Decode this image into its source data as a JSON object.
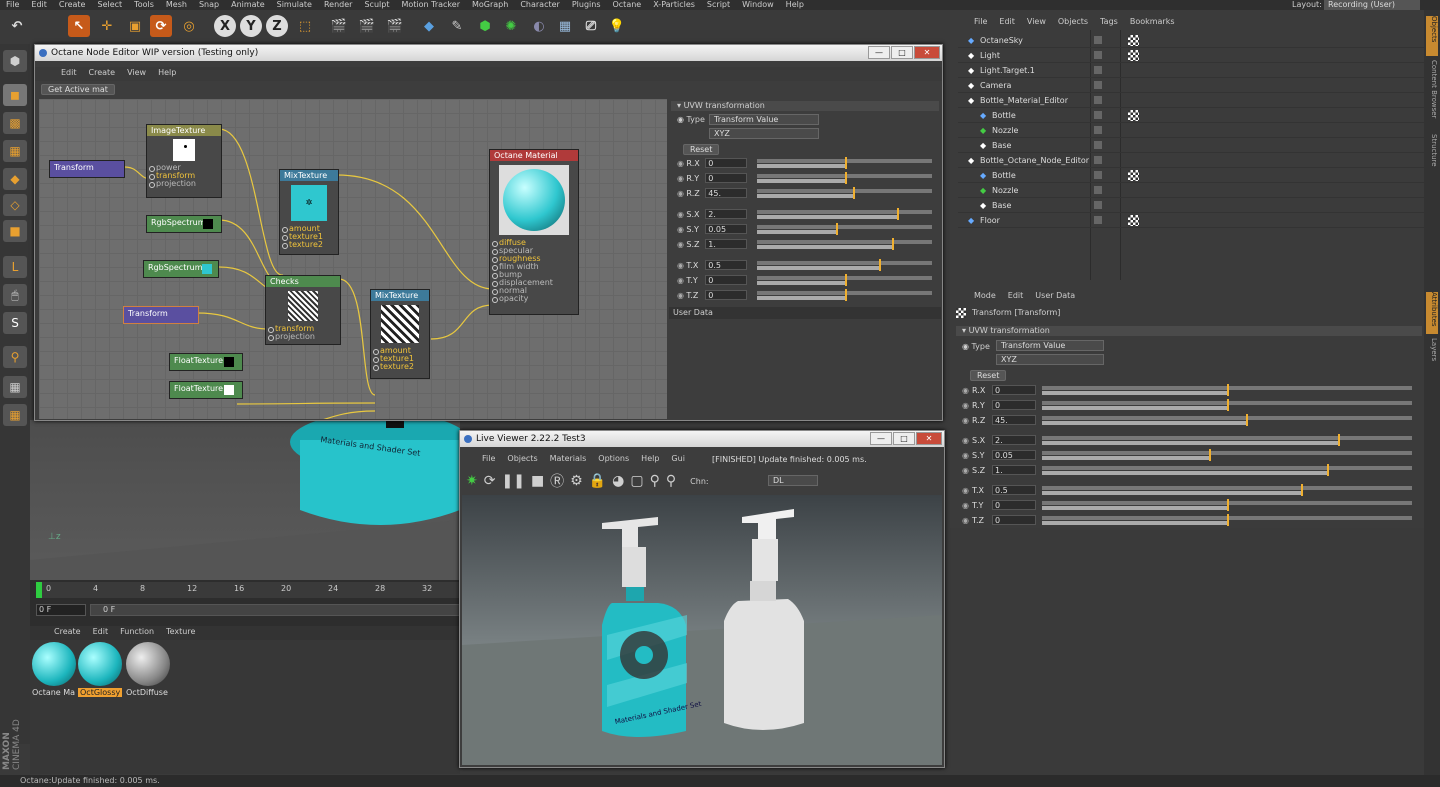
{
  "app": {
    "menu": [
      "File",
      "Edit",
      "Create",
      "Select",
      "Tools",
      "Mesh",
      "Snap",
      "Animate",
      "Simulate",
      "Render",
      "Sculpt",
      "Motion Tracker",
      "MoGraph",
      "Character",
      "Plugins",
      "Octane",
      "X-Particles",
      "Script",
      "Window",
      "Help"
    ],
    "layout_label": "Layout:",
    "layout_value": "Recording (User)",
    "status": "Octane:Update finished: 0.005 ms.",
    "brand1": "MAXON",
    "brand2": "CINEMA 4D"
  },
  "node_editor": {
    "title": "Octane Node Editor WIP version (Testing only)",
    "menu": [
      "Edit",
      "Create",
      "View",
      "Help"
    ],
    "get_active": "Get Active mat",
    "nodes": {
      "imagetexture": "ImageTexture",
      "transform1": "Transform",
      "rgb1": "RgbSpectrum",
      "rgb2": "RgbSpectrum",
      "mix1": "MixTexture",
      "checks": "Checks",
      "transform2": "Transform",
      "mix2": "MixTexture",
      "float1": "FloatTexture",
      "float2": "FloatTexture",
      "material": "Octane Material"
    },
    "img_ports": [
      "power",
      "transform",
      "projection"
    ],
    "mix_ports": [
      "amount",
      "texture1",
      "texture2"
    ],
    "checks_ports": [
      "transform",
      "projection"
    ],
    "mat_ports": [
      "diffuse",
      "specular",
      "roughness",
      "film width",
      "bump",
      "displacement",
      "normal",
      "opacity"
    ],
    "uvw": {
      "header": "UVW transformation",
      "type_label": "Type",
      "type_value": "Transform Value",
      "order": "XYZ",
      "reset": "Reset",
      "user_data": "User Data"
    }
  },
  "uvw_fields": [
    {
      "label": "R.X",
      "value": "0"
    },
    {
      "label": "R.Y",
      "value": "0"
    },
    {
      "label": "R.Z",
      "value": "45."
    },
    {
      "label": "S.X",
      "value": "2."
    },
    {
      "label": "S.Y",
      "value": "0.05"
    },
    {
      "label": "S.Z",
      "value": "1."
    },
    {
      "label": "T.X",
      "value": "0.5"
    },
    {
      "label": "T.Y",
      "value": "0"
    },
    {
      "label": "T.Z",
      "value": "0"
    }
  ],
  "live_viewer": {
    "title": "Live Viewer 2.22.2 Test3",
    "menu": [
      "File",
      "Objects",
      "Materials",
      "Options",
      "Help",
      "Gui"
    ],
    "status": "[FINISHED] Update finished: 0.005 ms.",
    "chn_label": "Chn:",
    "chn_value": "DL",
    "bottle_text": "Materials and Shader Set"
  },
  "objects": {
    "menu": [
      "File",
      "Edit",
      "View",
      "Objects",
      "Tags",
      "Bookmarks"
    ],
    "items": [
      "OctaneSky",
      "Light",
      "Light.Target.1",
      "Camera",
      "Bottle_Material_Editor",
      "Bottle",
      "Nozzle",
      "Base",
      "Bottle_Octane_Node_Editor",
      "Bottle",
      "Nozzle",
      "Base",
      "Floor"
    ]
  },
  "attributes": {
    "menu": [
      "Mode",
      "Edit",
      "User Data"
    ],
    "title": "Transform [Transform]",
    "header": "UVW transformation",
    "type_label": "Type",
    "type_value": "Transform Value",
    "order": "XYZ",
    "reset": "Reset"
  },
  "right_tabs": [
    "Objects",
    "Content Browser",
    "Structure",
    "Attributes",
    "Layers"
  ],
  "timeline": {
    "ticks": [
      "0",
      "4",
      "8",
      "12",
      "16",
      "20",
      "24",
      "28",
      "32"
    ],
    "frame": "0 F",
    "frame2": "0 F"
  },
  "materials": {
    "menu": [
      "Create",
      "Edit",
      "Function",
      "Texture"
    ],
    "items": [
      "Octane Ma",
      "OctGlossy",
      "OctDiffuse"
    ]
  },
  "viewport": {
    "label": "Materials and Shader Set"
  },
  "colors": {
    "accent": "#f0b030",
    "teal": "#2fc7cf",
    "node_purple": "#5a4fa0",
    "node_green": "#4e8a4e",
    "node_yellow": "#8a8a4a",
    "node_blue": "#3d7a9a",
    "node_red": "#b03a3a"
  }
}
